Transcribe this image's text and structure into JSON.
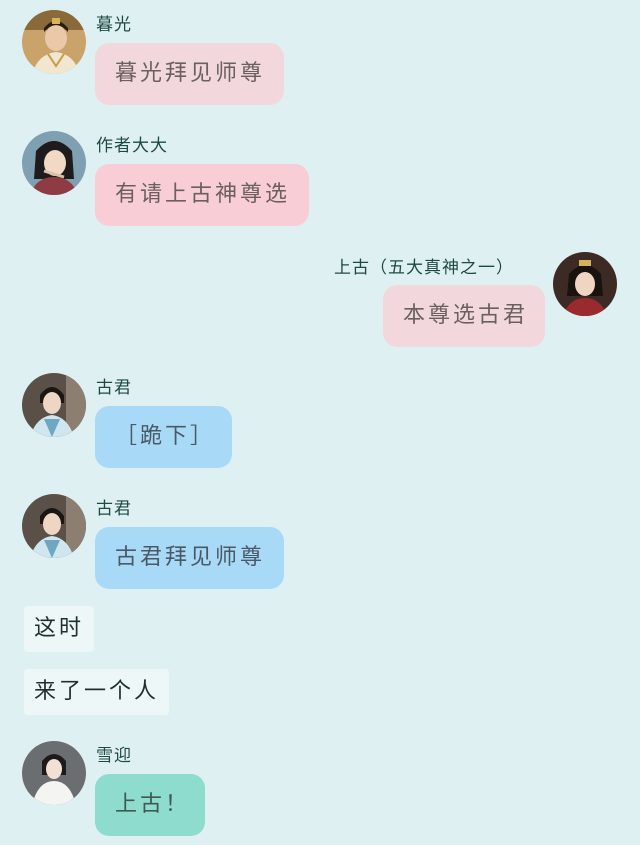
{
  "messages": [
    {
      "sender": "暮光",
      "text": "暮光拜见师尊",
      "avatar_icon": "avatar-muguang-icon"
    },
    {
      "sender": "作者大大",
      "text": "有请上古神尊选",
      "avatar_icon": "avatar-author-icon"
    },
    {
      "sender": "上古（五大真神之一）",
      "text": "本尊选古君",
      "avatar_icon": "avatar-shanggu-icon"
    },
    {
      "sender": "古君",
      "text": "［跪下］",
      "avatar_icon": "avatar-gujun-icon"
    },
    {
      "sender": "古君",
      "text": "古君拜见师尊",
      "avatar_icon": "avatar-gujun-icon"
    },
    {
      "sender": "雪迎",
      "text": "上古！",
      "avatar_icon": "avatar-xueying-icon"
    }
  ],
  "narration": [
    "这时",
    "来了一个人"
  ],
  "colors": {
    "background": "#dff0f3",
    "bubble_pink": "#f2d8dc",
    "bubble_rose": "#f8cdd6",
    "bubble_blue": "#a8daf8",
    "bubble_teal": "#8edccd",
    "narration_bg": "#eef7f8"
  }
}
